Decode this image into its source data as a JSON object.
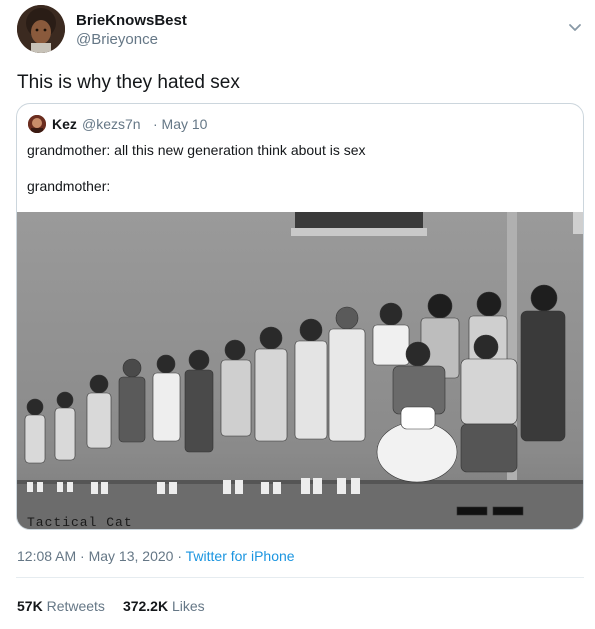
{
  "tweet": {
    "author_name": "BrieKnowsBest",
    "author_handle": "@Brieyonce",
    "text": "This is why they hated sex",
    "time": "12:08 AM · May 13, 2020 · ",
    "source": "Twitter for iPhone",
    "retweets_count": "57K",
    "retweets_label": "Retweets",
    "likes_count": "372.2K",
    "likes_label": "Likes"
  },
  "quoted": {
    "author_name": "Kez",
    "author_handle": "@kezs7n",
    "date": "· May 10",
    "line1": "grandmother: all this new generation think about is sex",
    "line2": "grandmother:",
    "watermark": "Tactical Cat"
  },
  "icons": {
    "menu": "chevron-down-icon"
  }
}
